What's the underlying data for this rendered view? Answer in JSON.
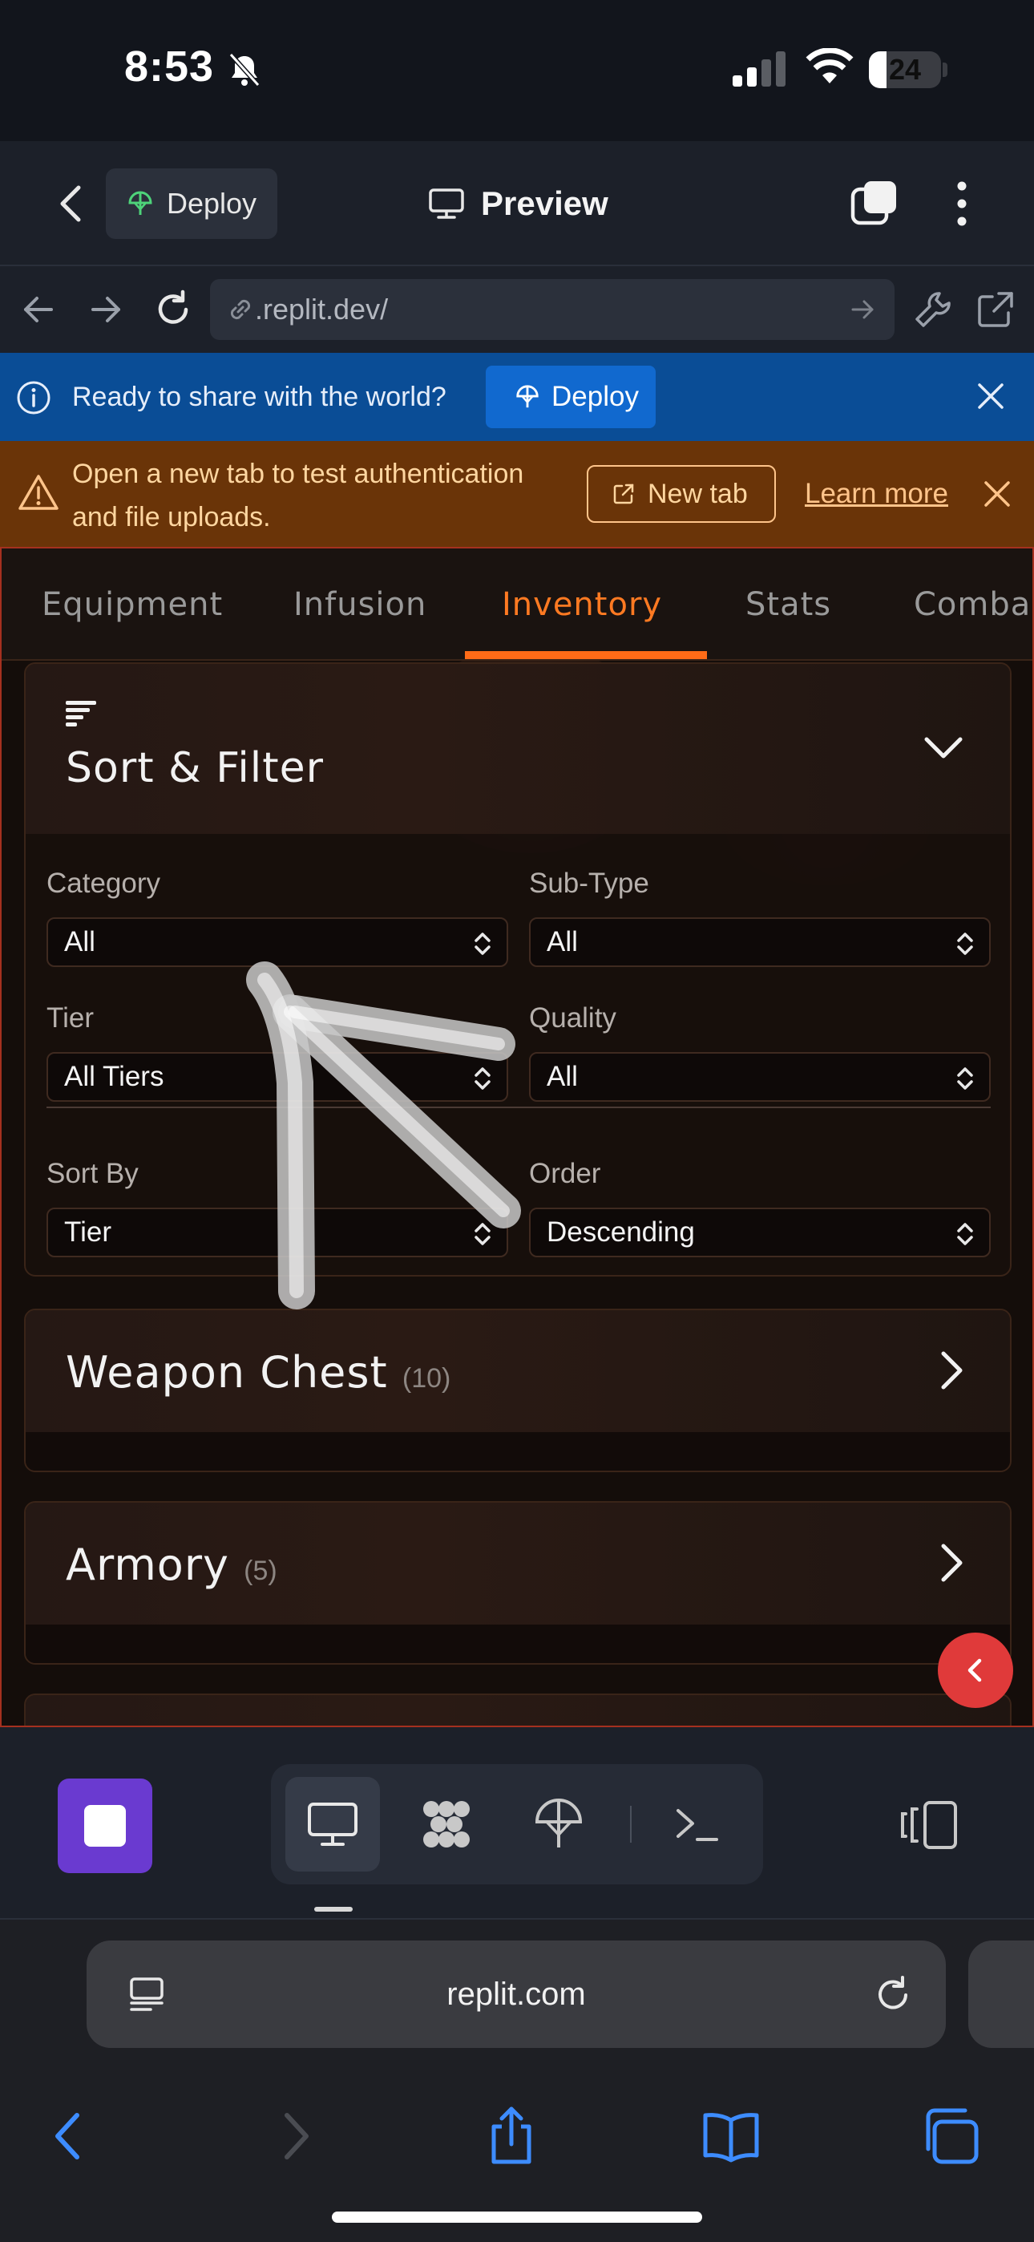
{
  "status_bar": {
    "time": "8:53",
    "battery": "24",
    "battery_level": 0.24
  },
  "header": {
    "deploy_label": "Deploy",
    "preview_label": "Preview"
  },
  "url_bar": {
    "url": ".replit.dev/"
  },
  "share_banner": {
    "text": "Ready to share with the world?",
    "deploy_label": "Deploy"
  },
  "warn_banner": {
    "line1": "Open a new tab to test authentication",
    "line2": "and file uploads.",
    "new_tab_label": "New tab",
    "learn_more_label": "Learn more"
  },
  "tabs": [
    {
      "label": "Equipment",
      "active": false
    },
    {
      "label": "Infusion",
      "active": false
    },
    {
      "label": "Inventory",
      "active": true
    },
    {
      "label": "Stats",
      "active": false
    },
    {
      "label": "Comba",
      "active": false
    }
  ],
  "filter_panel": {
    "title": "Sort & Filter",
    "fields": [
      {
        "label": "Category",
        "value": "All"
      },
      {
        "label": "Sub-Type",
        "value": "All"
      },
      {
        "label": "Tier",
        "value": "All Tiers"
      },
      {
        "label": "Quality",
        "value": "All"
      },
      {
        "label": "Sort By",
        "value": "Tier"
      },
      {
        "label": "Order",
        "value": "Descending"
      }
    ]
  },
  "sections": [
    {
      "title": "Weapon Chest",
      "count": "(10)"
    },
    {
      "title": "Armory",
      "count": "(5)"
    }
  ],
  "safari": {
    "domain": "replit.com"
  },
  "colors": {
    "accent": "#ff6b17",
    "frame_border": "#a5301f",
    "deploy_blue": "#1169cf",
    "stop_purple": "#6a3ad0"
  }
}
